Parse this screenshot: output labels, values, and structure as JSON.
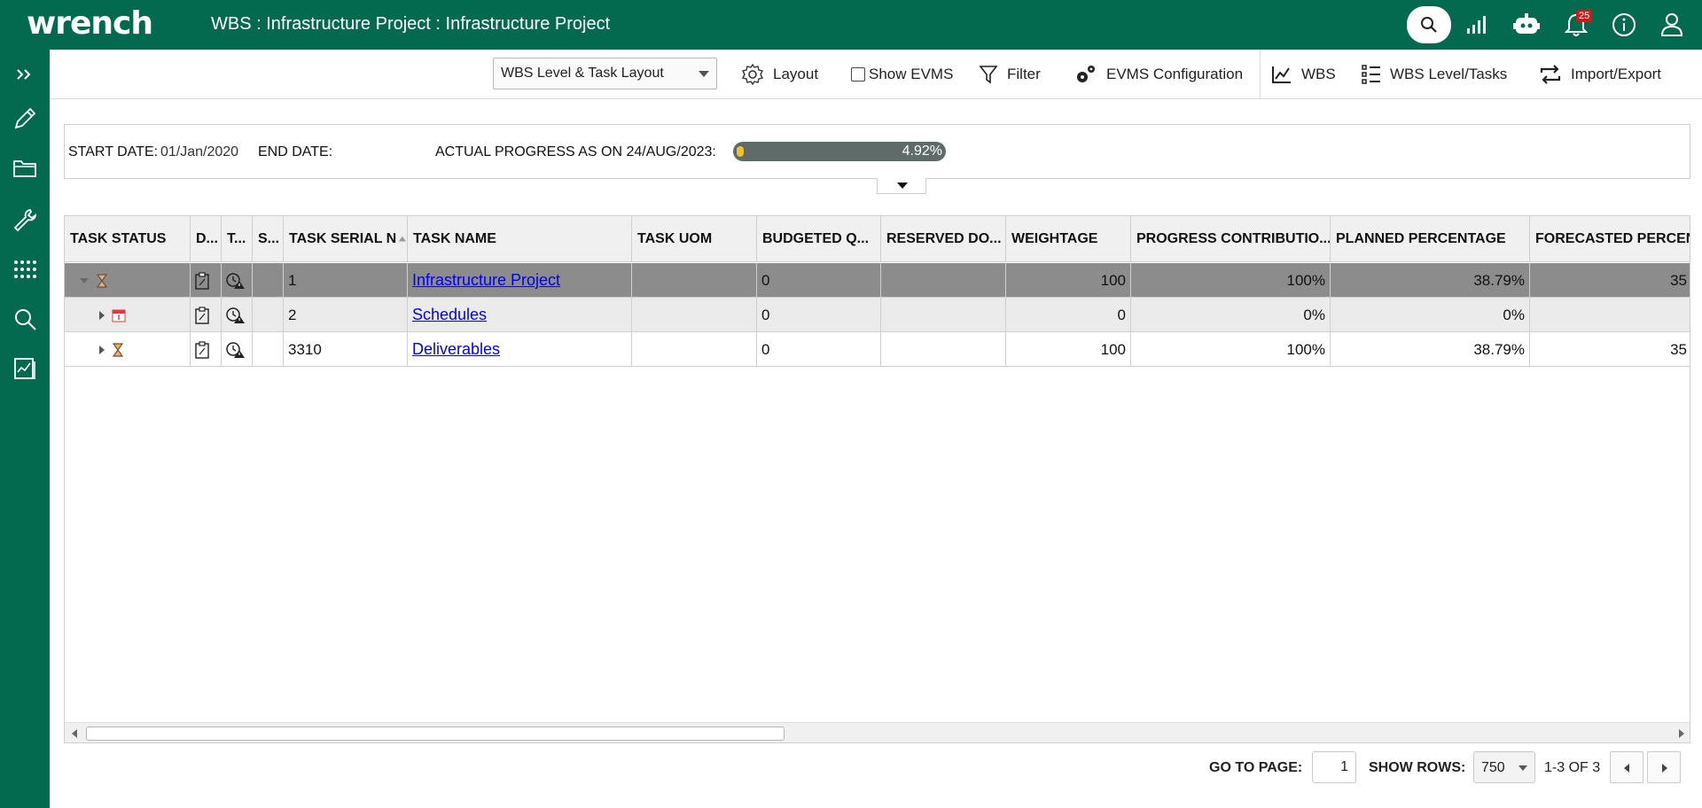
{
  "app": {
    "logo": "wrench",
    "title": "WBS : Infrastructure Project : Infrastructure Project"
  },
  "top_icons": {
    "notification_count": "25"
  },
  "toolbar": {
    "layout_select": "WBS Level & Task Layout",
    "layout_label": "Layout",
    "show_evms_label": "Show EVMS",
    "filter_label": "Filter",
    "evms_config_label": "EVMS Configuration",
    "wbs_label": "WBS",
    "wbs_level_tasks_label": "WBS Level/Tasks",
    "import_export_label": "Import/Export"
  },
  "info": {
    "start_date_label": "START DATE:",
    "start_date": "01/Jan/2020",
    "end_date_label": "END DATE:",
    "actual_progress_label": "ACTUAL PROGRESS AS ON 24/AUG/2023:",
    "actual_progress_value": "4.92%"
  },
  "grid": {
    "columns": [
      "TASK STATUS",
      "D...",
      "T...",
      "S...",
      "TASK SERIAL N",
      "TASK NAME",
      "TASK UOM",
      "BUDGETED Q...",
      "RESERVED DO...",
      "WEIGHTAGE",
      "PROGRESS CONTRIBUTIO...",
      "PLANNED PERCENTAGE",
      "FORECASTED PERCENT"
    ],
    "rows": [
      {
        "serial": "1",
        "name": "Infrastructure Project",
        "uom": "",
        "budgeted": "0",
        "reserved": "",
        "weightage": "100",
        "progress": "100%",
        "planned": "38.79%",
        "forecasted": "35"
      },
      {
        "serial": "2",
        "name": "Schedules",
        "uom": "",
        "budgeted": "0",
        "reserved": "",
        "weightage": "0",
        "progress": "0%",
        "planned": "0%",
        "forecasted": ""
      },
      {
        "serial": "3310",
        "name": "Deliverables",
        "uom": "",
        "budgeted": "0",
        "reserved": "",
        "weightage": "100",
        "progress": "100%",
        "planned": "38.79%",
        "forecasted": "35"
      }
    ]
  },
  "pager": {
    "go_to_page_label": "GO TO PAGE:",
    "page_value": "1",
    "show_rows_label": "SHOW ROWS:",
    "show_rows_value": "750",
    "range_text": "1-3 OF 3"
  },
  "colors": {
    "brand": "#046a4f",
    "selected_row": "#8c8c8c",
    "progress_fill": "#f3c12b"
  }
}
